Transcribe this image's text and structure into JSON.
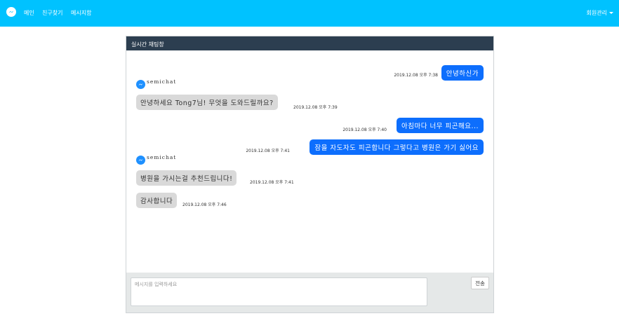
{
  "nav": {
    "items": [
      {
        "label": "메인"
      },
      {
        "label": "친구찾기"
      },
      {
        "label": "메시지함"
      }
    ],
    "account_label": "회원관리"
  },
  "chat": {
    "title": "실시간 채팅창",
    "messages": [
      {
        "from": "me",
        "text": "안녕하신가",
        "time": "2019.12.08 오후 7:38"
      },
      {
        "from": "bot",
        "sender": "semichat",
        "text": "안녕하세요 Tong7님! 무엇을 도와드릴까요?",
        "time": "2019.12.08 오후 7:39"
      },
      {
        "from": "me",
        "text": "아침마다 너무 피곤해요...",
        "time": "2019.12.08 오후 7:40"
      },
      {
        "from": "me",
        "text": "잠을 자도자도 피곤합니다 그렇다고 병원은 가기 싫어요",
        "time": "2019.12.08 오후 7:41"
      },
      {
        "from": "bot",
        "sender": "semichat",
        "text": "병원을 가시는걸 추천드립니다!",
        "time": "2019.12.08 오후 7:41"
      },
      {
        "from": "bot",
        "text": "감사합니다",
        "time": "2019.12.08 오후 7:46"
      }
    ]
  },
  "input": {
    "placeholder": "메시지를 입력하세요",
    "send_label": "전송"
  },
  "colors": {
    "navbar": "#00c2ff",
    "panel_header": "#2c3e50",
    "my_bubble": "#0d6efd",
    "bot_bubble": "#d9d9d9",
    "footer": "#e5e8e8"
  },
  "icons": [
    "messenger-logo-icon",
    "messenger-avatar-icon",
    "caret-down-icon"
  ]
}
